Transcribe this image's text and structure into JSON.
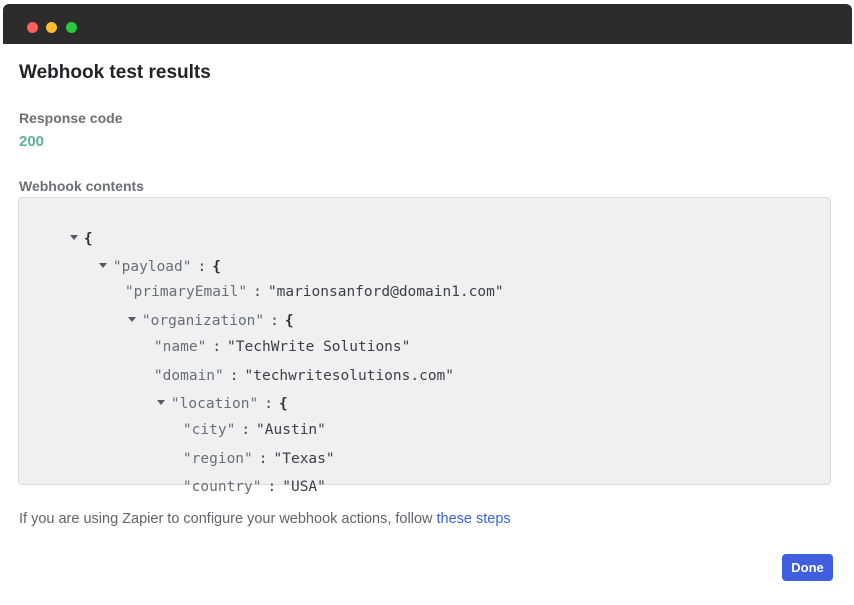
{
  "window": {
    "title": ""
  },
  "dialog": {
    "title": "Webhook test results",
    "response_code_label": "Response code",
    "response_code_value": "200",
    "contents_label": "Webhook contents"
  },
  "json_view": {
    "root_open": "{",
    "payload_key": "\"payload\"",
    "primary_email_key": "\"primaryEmail\"",
    "primary_email_value": "\"marionsanford@domain1.com\"",
    "organization_key": "\"organization\"",
    "name_key": "\"name\"",
    "name_value": "\"TechWrite Solutions\"",
    "domain_key": "\"domain\"",
    "domain_value": "\"techwritesolutions.com\"",
    "location_key": "\"location\"",
    "city_key": "\"city\"",
    "city_value": "\"Austin\"",
    "region_key": "\"region\"",
    "region_value": "\"Texas\"",
    "country_key": "\"country\"",
    "country_value": "\"USA\"",
    "colon": ":",
    "open_brace": "{"
  },
  "footer": {
    "text": "If you are using Zapier to configure your webhook actions, follow ",
    "link": "these steps"
  },
  "done_label": "Done",
  "colors": {
    "titlebar": "#2c2c2c",
    "response_code": "#5bb39a",
    "link": "#3c63dd",
    "primary_button": "#3f5fe0"
  }
}
